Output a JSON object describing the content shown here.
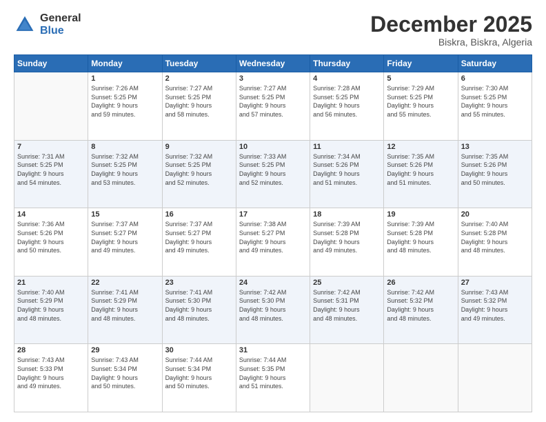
{
  "header": {
    "logo_general": "General",
    "logo_blue": "Blue",
    "month_title": "December 2025",
    "location": "Biskra, Biskra, Algeria"
  },
  "days_of_week": [
    "Sunday",
    "Monday",
    "Tuesday",
    "Wednesday",
    "Thursday",
    "Friday",
    "Saturday"
  ],
  "weeks": [
    [
      {
        "day": "",
        "info": ""
      },
      {
        "day": "1",
        "info": "Sunrise: 7:26 AM\nSunset: 5:25 PM\nDaylight: 9 hours\nand 59 minutes."
      },
      {
        "day": "2",
        "info": "Sunrise: 7:27 AM\nSunset: 5:25 PM\nDaylight: 9 hours\nand 58 minutes."
      },
      {
        "day": "3",
        "info": "Sunrise: 7:27 AM\nSunset: 5:25 PM\nDaylight: 9 hours\nand 57 minutes."
      },
      {
        "day": "4",
        "info": "Sunrise: 7:28 AM\nSunset: 5:25 PM\nDaylight: 9 hours\nand 56 minutes."
      },
      {
        "day": "5",
        "info": "Sunrise: 7:29 AM\nSunset: 5:25 PM\nDaylight: 9 hours\nand 55 minutes."
      },
      {
        "day": "6",
        "info": "Sunrise: 7:30 AM\nSunset: 5:25 PM\nDaylight: 9 hours\nand 55 minutes."
      }
    ],
    [
      {
        "day": "7",
        "info": "Sunrise: 7:31 AM\nSunset: 5:25 PM\nDaylight: 9 hours\nand 54 minutes."
      },
      {
        "day": "8",
        "info": "Sunrise: 7:32 AM\nSunset: 5:25 PM\nDaylight: 9 hours\nand 53 minutes."
      },
      {
        "day": "9",
        "info": "Sunrise: 7:32 AM\nSunset: 5:25 PM\nDaylight: 9 hours\nand 52 minutes."
      },
      {
        "day": "10",
        "info": "Sunrise: 7:33 AM\nSunset: 5:25 PM\nDaylight: 9 hours\nand 52 minutes."
      },
      {
        "day": "11",
        "info": "Sunrise: 7:34 AM\nSunset: 5:26 PM\nDaylight: 9 hours\nand 51 minutes."
      },
      {
        "day": "12",
        "info": "Sunrise: 7:35 AM\nSunset: 5:26 PM\nDaylight: 9 hours\nand 51 minutes."
      },
      {
        "day": "13",
        "info": "Sunrise: 7:35 AM\nSunset: 5:26 PM\nDaylight: 9 hours\nand 50 minutes."
      }
    ],
    [
      {
        "day": "14",
        "info": "Sunrise: 7:36 AM\nSunset: 5:26 PM\nDaylight: 9 hours\nand 50 minutes."
      },
      {
        "day": "15",
        "info": "Sunrise: 7:37 AM\nSunset: 5:27 PM\nDaylight: 9 hours\nand 49 minutes."
      },
      {
        "day": "16",
        "info": "Sunrise: 7:37 AM\nSunset: 5:27 PM\nDaylight: 9 hours\nand 49 minutes."
      },
      {
        "day": "17",
        "info": "Sunrise: 7:38 AM\nSunset: 5:27 PM\nDaylight: 9 hours\nand 49 minutes."
      },
      {
        "day": "18",
        "info": "Sunrise: 7:39 AM\nSunset: 5:28 PM\nDaylight: 9 hours\nand 49 minutes."
      },
      {
        "day": "19",
        "info": "Sunrise: 7:39 AM\nSunset: 5:28 PM\nDaylight: 9 hours\nand 48 minutes."
      },
      {
        "day": "20",
        "info": "Sunrise: 7:40 AM\nSunset: 5:28 PM\nDaylight: 9 hours\nand 48 minutes."
      }
    ],
    [
      {
        "day": "21",
        "info": "Sunrise: 7:40 AM\nSunset: 5:29 PM\nDaylight: 9 hours\nand 48 minutes."
      },
      {
        "day": "22",
        "info": "Sunrise: 7:41 AM\nSunset: 5:29 PM\nDaylight: 9 hours\nand 48 minutes."
      },
      {
        "day": "23",
        "info": "Sunrise: 7:41 AM\nSunset: 5:30 PM\nDaylight: 9 hours\nand 48 minutes."
      },
      {
        "day": "24",
        "info": "Sunrise: 7:42 AM\nSunset: 5:30 PM\nDaylight: 9 hours\nand 48 minutes."
      },
      {
        "day": "25",
        "info": "Sunrise: 7:42 AM\nSunset: 5:31 PM\nDaylight: 9 hours\nand 48 minutes."
      },
      {
        "day": "26",
        "info": "Sunrise: 7:42 AM\nSunset: 5:32 PM\nDaylight: 9 hours\nand 48 minutes."
      },
      {
        "day": "27",
        "info": "Sunrise: 7:43 AM\nSunset: 5:32 PM\nDaylight: 9 hours\nand 49 minutes."
      }
    ],
    [
      {
        "day": "28",
        "info": "Sunrise: 7:43 AM\nSunset: 5:33 PM\nDaylight: 9 hours\nand 49 minutes."
      },
      {
        "day": "29",
        "info": "Sunrise: 7:43 AM\nSunset: 5:34 PM\nDaylight: 9 hours\nand 50 minutes."
      },
      {
        "day": "30",
        "info": "Sunrise: 7:44 AM\nSunset: 5:34 PM\nDaylight: 9 hours\nand 50 minutes."
      },
      {
        "day": "31",
        "info": "Sunrise: 7:44 AM\nSunset: 5:35 PM\nDaylight: 9 hours\nand 51 minutes."
      },
      {
        "day": "",
        "info": ""
      },
      {
        "day": "",
        "info": ""
      },
      {
        "day": "",
        "info": ""
      }
    ]
  ]
}
